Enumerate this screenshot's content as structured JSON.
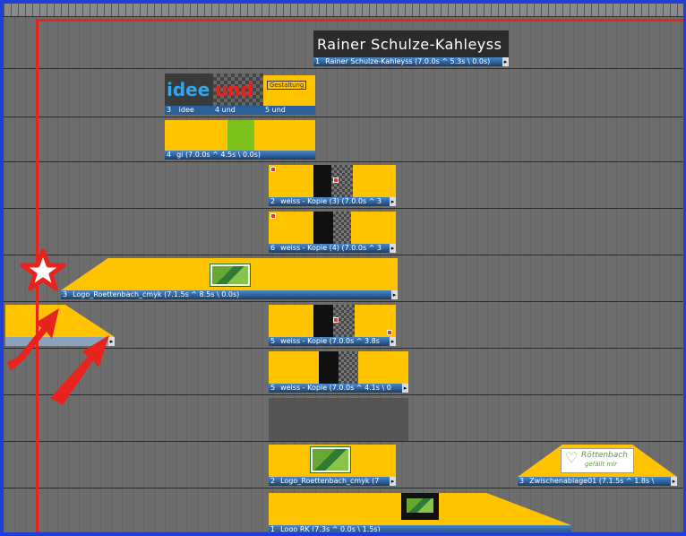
{
  "timeline": {
    "title_clip_text": "Rainer Schulze-Kahleyss",
    "idee_text": "idee",
    "und_text": "und",
    "gestaltung_text": "Gestaltung",
    "logo_caption": "RÖTTENBACH",
    "zw_logo_text": "Röttenbach",
    "zw_logo_sub": "gefällt mir",
    "clips": [
      {
        "num": "1",
        "label": "Rainer Schulze-Kahleyss (7.0.0s ^ 5.3s \\ 0.0s)"
      },
      {
        "num": "3",
        "label": "idee"
      },
      {
        "num": "4",
        "label": "und"
      },
      {
        "num": "5",
        "label": "und"
      },
      {
        "num": "4",
        "label": "gi (7.0.0s ^ 4.5s \\ 0.0s)"
      },
      {
        "num": "2",
        "label": "weiss - Kopie (3) (7.0.0s ^ 3"
      },
      {
        "num": "6",
        "label": "weiss - Kopie (4) (7.0.0s ^ 3"
      },
      {
        "num": "3",
        "label": "Logo_Roettenbach_cmyk (7.1.5s ^ 8.5s \\ 0.0s)"
      },
      {
        "num": "5",
        "label": "weiss - Kopie (7.0.0s ^ 3.8s"
      },
      {
        "num": "5",
        "label": "weiss - Kopie (7.0.0s ^ 4.1s \\ 0"
      },
      {
        "num": "2",
        "label": "Logo_Roettenbach_cmyk (7"
      },
      {
        "num": "3",
        "label": "Zwischenablage01 (7.1.5s ^ 1.8s \\"
      },
      {
        "num": "1",
        "label": "Logo RK (7.3s ^ 0.0s \\ 1.5s)"
      }
    ]
  },
  "colors": {
    "clip_fill": "#ffc300",
    "clip_bar": "#2b5f99",
    "highlight_frame": "#e8231e",
    "window_border": "#1f3fd6"
  }
}
